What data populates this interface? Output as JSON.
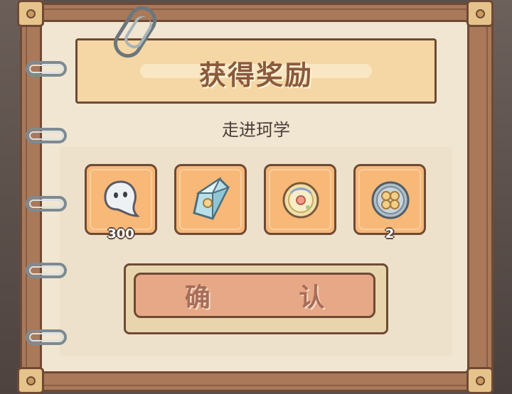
{
  "dialog": {
    "title": "获得奖励",
    "subtitle": "走进珂学",
    "confirm_label": "确 认"
  },
  "rewards": [
    {
      "icon": "ghost-icon",
      "count": "300"
    },
    {
      "icon": "crystal-icon",
      "count": ""
    },
    {
      "icon": "orb-icon",
      "count": ""
    },
    {
      "icon": "clover-coin-icon",
      "count": "2"
    }
  ],
  "colors": {
    "paper": "#f1e6d2",
    "banner": "#f4d7a4",
    "slot": "#f8b878",
    "button": "#e6a886",
    "border": "#6e4a35"
  }
}
